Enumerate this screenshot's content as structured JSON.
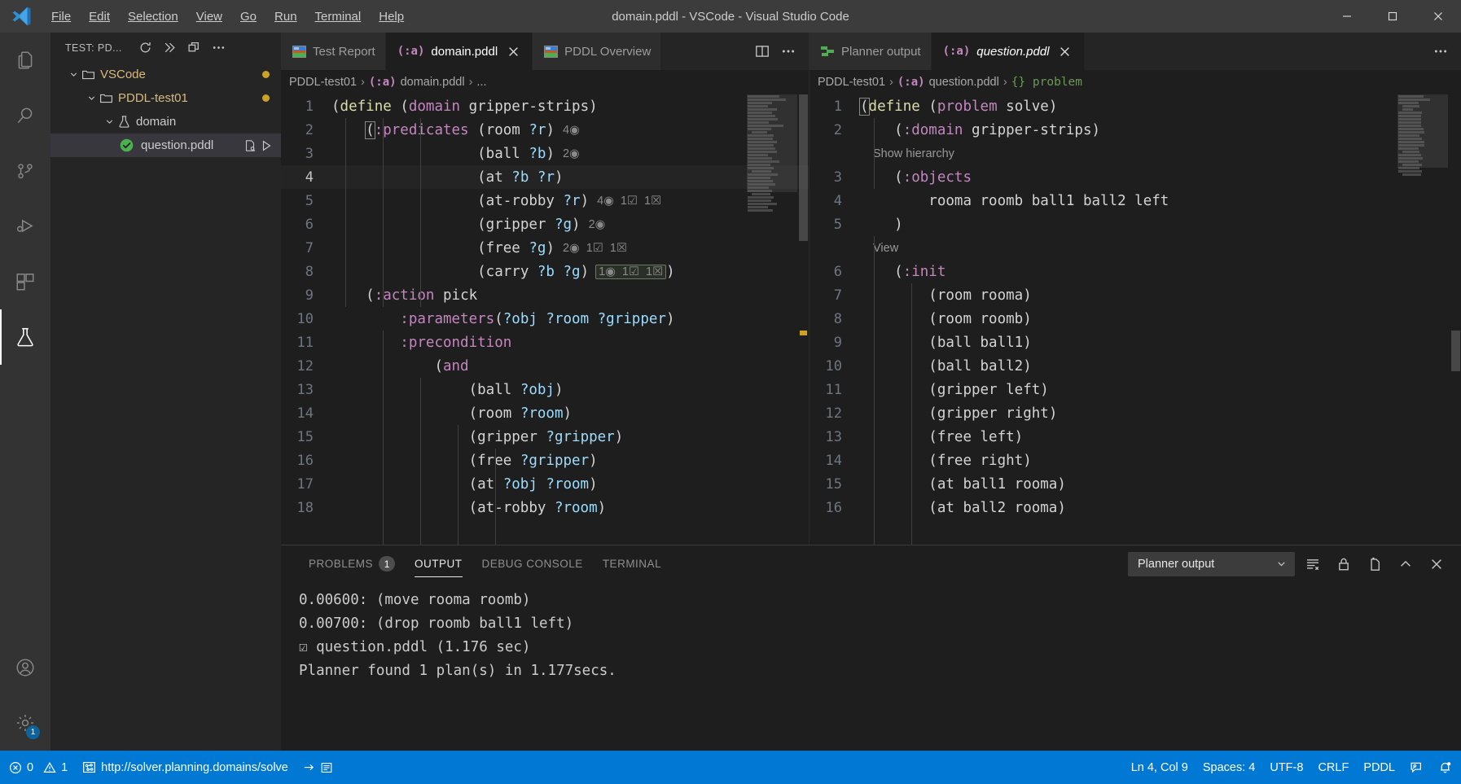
{
  "titlebar": {
    "title": "domain.pddl - VSCode - Visual Studio Code",
    "menus": [
      "File",
      "Edit",
      "Selection",
      "View",
      "Go",
      "Run",
      "Terminal",
      "Help"
    ],
    "minimize": "–",
    "maximize": "☐",
    "close": "✕"
  },
  "sidebar": {
    "header": "TEST: PD...",
    "tree": [
      {
        "label": "VSCode",
        "type": "folder",
        "indent": 0,
        "dot": true
      },
      {
        "label": "PDDL-test01",
        "type": "folder",
        "indent": 1,
        "dot": true
      },
      {
        "label": "domain",
        "type": "flask",
        "indent": 2,
        "dot": false
      },
      {
        "label": "question.pddl",
        "type": "test-pass",
        "indent": 3,
        "dot": false,
        "selected": true
      }
    ]
  },
  "left_group": {
    "tabs": [
      {
        "label": "Test Report",
        "icon": "image-icon",
        "active": false,
        "closable": false
      },
      {
        "label": "domain.pddl",
        "icon": "pddl-icon",
        "active": true,
        "closable": true
      },
      {
        "label": "PDDL Overview",
        "icon": "image-icon",
        "active": false,
        "closable": false
      }
    ],
    "breadcrumb": [
      "PDDL-test01",
      "domain.pddl",
      "..."
    ],
    "lines": [
      {
        "n": "1",
        "segs": [
          {
            "t": "(",
            "c": "paren"
          },
          {
            "t": "define ",
            "c": "name"
          },
          {
            "t": "(",
            "c": "paren"
          },
          {
            "t": "domain ",
            "c": "kw"
          },
          {
            "t": "gripper-strips",
            "c": "plain"
          },
          {
            "t": ")",
            "c": "paren"
          }
        ],
        "indent": 0
      },
      {
        "n": "2",
        "segs": [
          {
            "t": "    ",
            "c": "plain"
          },
          {
            "t": "(",
            "c": "paren",
            "cursor": true
          },
          {
            "t": ":predicates ",
            "c": "kw"
          },
          {
            "t": "(",
            "c": "paren"
          },
          {
            "t": "room ",
            "c": "pred"
          },
          {
            "t": "?r",
            "c": "var"
          },
          {
            "t": ")",
            "c": "paren"
          }
        ],
        "lens": "4◉",
        "indent": 1
      },
      {
        "n": "3",
        "segs": [
          {
            "t": "                 ",
            "c": "plain"
          },
          {
            "t": "(",
            "c": "paren"
          },
          {
            "t": "ball ",
            "c": "pred"
          },
          {
            "t": "?b",
            "c": "var"
          },
          {
            "t": ")",
            "c": "paren"
          }
        ],
        "lens": "2◉",
        "indent": 3
      },
      {
        "n": "4",
        "segs": [
          {
            "t": "                 ",
            "c": "plain"
          },
          {
            "t": "(",
            "c": "paren"
          },
          {
            "t": "at ",
            "c": "pred"
          },
          {
            "t": "?b ?r",
            "c": "var"
          },
          {
            "t": ")",
            "c": "paren"
          }
        ],
        "lens": "",
        "indent": 3,
        "current": true
      },
      {
        "n": "5",
        "segs": [
          {
            "t": "                 ",
            "c": "plain"
          },
          {
            "t": "(",
            "c": "paren"
          },
          {
            "t": "at-robby ",
            "c": "pred"
          },
          {
            "t": "?r",
            "c": "var"
          },
          {
            "t": ")",
            "c": "paren"
          }
        ],
        "lens": "4◉  1☑  1☒",
        "indent": 3
      },
      {
        "n": "6",
        "segs": [
          {
            "t": "                 ",
            "c": "plain"
          },
          {
            "t": "(",
            "c": "paren"
          },
          {
            "t": "gripper ",
            "c": "pred"
          },
          {
            "t": "?g",
            "c": "var"
          },
          {
            "t": ")",
            "c": "paren"
          }
        ],
        "lens": "2◉",
        "indent": 3
      },
      {
        "n": "7",
        "segs": [
          {
            "t": "                 ",
            "c": "plain"
          },
          {
            "t": "(",
            "c": "paren"
          },
          {
            "t": "free ",
            "c": "pred"
          },
          {
            "t": "?g",
            "c": "var"
          },
          {
            "t": ")",
            "c": "paren"
          }
        ],
        "lens": "2◉  1☑  1☒",
        "indent": 3
      },
      {
        "n": "8",
        "segs": [
          {
            "t": "                 ",
            "c": "plain"
          },
          {
            "t": "(",
            "c": "paren"
          },
          {
            "t": "carry ",
            "c": "pred"
          },
          {
            "t": "?b ?g",
            "c": "var"
          },
          {
            "t": ")",
            "c": "paren"
          }
        ],
        "lens_boxed": "1◉  1☑  1☒",
        "trail": ")",
        "indent": 3
      },
      {
        "n": "9",
        "segs": [
          {
            "t": "    ",
            "c": "plain"
          },
          {
            "t": "(",
            "c": "paren"
          },
          {
            "t": ":action ",
            "c": "kw"
          },
          {
            "t": "pick",
            "c": "plain"
          }
        ],
        "indent": 1
      },
      {
        "n": "10",
        "segs": [
          {
            "t": "        ",
            "c": "plain"
          },
          {
            "t": ":parameters",
            "c": "kw"
          },
          {
            "t": "(",
            "c": "paren"
          },
          {
            "t": "?obj ?room ?gripper",
            "c": "var"
          },
          {
            "t": ")",
            "c": "paren"
          }
        ],
        "indent": 2
      },
      {
        "n": "11",
        "segs": [
          {
            "t": "        ",
            "c": "plain"
          },
          {
            "t": ":precondition",
            "c": "kw"
          }
        ],
        "indent": 2
      },
      {
        "n": "12",
        "segs": [
          {
            "t": "            ",
            "c": "plain"
          },
          {
            "t": "(",
            "c": "paren"
          },
          {
            "t": "and",
            "c": "kw"
          }
        ],
        "indent": 3
      },
      {
        "n": "13",
        "segs": [
          {
            "t": "                ",
            "c": "plain"
          },
          {
            "t": "(",
            "c": "paren"
          },
          {
            "t": "ball ",
            "c": "pred"
          },
          {
            "t": "?obj",
            "c": "var"
          },
          {
            "t": ")",
            "c": "paren"
          }
        ],
        "indent": 4
      },
      {
        "n": "14",
        "segs": [
          {
            "t": "                ",
            "c": "plain"
          },
          {
            "t": "(",
            "c": "paren"
          },
          {
            "t": "room ",
            "c": "pred"
          },
          {
            "t": "?room",
            "c": "var"
          },
          {
            "t": ")",
            "c": "paren"
          }
        ],
        "indent": 4
      },
      {
        "n": "15",
        "segs": [
          {
            "t": "                ",
            "c": "plain"
          },
          {
            "t": "(",
            "c": "paren"
          },
          {
            "t": "gripper ",
            "c": "pred"
          },
          {
            "t": "?gripper",
            "c": "var"
          },
          {
            "t": ")",
            "c": "paren"
          }
        ],
        "indent": 4
      },
      {
        "n": "16",
        "segs": [
          {
            "t": "                ",
            "c": "plain"
          },
          {
            "t": "(",
            "c": "paren"
          },
          {
            "t": "free ",
            "c": "pred"
          },
          {
            "t": "?gripper",
            "c": "var"
          },
          {
            "t": ")",
            "c": "paren"
          }
        ],
        "indent": 4
      },
      {
        "n": "17",
        "segs": [
          {
            "t": "                ",
            "c": "plain"
          },
          {
            "t": "(",
            "c": "paren"
          },
          {
            "t": "at ",
            "c": "pred"
          },
          {
            "t": "?obj ?room",
            "c": "var"
          },
          {
            "t": ")",
            "c": "paren"
          }
        ],
        "indent": 4
      },
      {
        "n": "18",
        "segs": [
          {
            "t": "                ",
            "c": "plain"
          },
          {
            "t": "(",
            "c": "paren"
          },
          {
            "t": "at-robby ",
            "c": "pred"
          },
          {
            "t": "?room",
            "c": "var"
          },
          {
            "t": ")",
            "c": "paren"
          }
        ],
        "indent": 4
      }
    ]
  },
  "right_group": {
    "tabs": [
      {
        "label": "Planner output",
        "icon": "planner-icon",
        "active": false,
        "closable": false
      },
      {
        "label": "question.pddl",
        "icon": "pddl-icon",
        "active": true,
        "closable": true,
        "italic": true
      }
    ],
    "breadcrumb": [
      "PDDL-test01",
      "question.pddl",
      "{} problem"
    ],
    "lines": [
      {
        "n": "1",
        "segs": [
          {
            "t": "(",
            "c": "paren",
            "cursor": true
          },
          {
            "t": "define ",
            "c": "name"
          },
          {
            "t": "(",
            "c": "paren"
          },
          {
            "t": "problem ",
            "c": "kw"
          },
          {
            "t": "solve",
            "c": "plain"
          },
          {
            "t": ")",
            "c": "paren"
          }
        ]
      },
      {
        "n": "2",
        "segs": [
          {
            "t": "    ",
            "c": "plain"
          },
          {
            "t": "(",
            "c": "paren"
          },
          {
            "t": ":domain ",
            "c": "kw"
          },
          {
            "t": "gripper-strips",
            "c": "plain"
          },
          {
            "t": ")",
            "c": "paren"
          }
        ]
      },
      {
        "n": "",
        "codelens": "Show hierarchy"
      },
      {
        "n": "3",
        "segs": [
          {
            "t": "    ",
            "c": "plain"
          },
          {
            "t": "(",
            "c": "paren"
          },
          {
            "t": ":objects",
            "c": "kw"
          }
        ]
      },
      {
        "n": "4",
        "segs": [
          {
            "t": "        ",
            "c": "plain"
          },
          {
            "t": "rooma roomb ball1 ball2 left",
            "c": "plain"
          }
        ]
      },
      {
        "n": "5",
        "segs": [
          {
            "t": "    ",
            "c": "plain"
          },
          {
            "t": ")",
            "c": "paren"
          }
        ]
      },
      {
        "n": "",
        "codelens": "View"
      },
      {
        "n": "6",
        "segs": [
          {
            "t": "    ",
            "c": "plain"
          },
          {
            "t": "(",
            "c": "paren"
          },
          {
            "t": ":init",
            "c": "kw"
          }
        ]
      },
      {
        "n": "7",
        "segs": [
          {
            "t": "        ",
            "c": "plain"
          },
          {
            "t": "(",
            "c": "paren"
          },
          {
            "t": "room rooma",
            "c": "plain"
          },
          {
            "t": ")",
            "c": "paren"
          }
        ]
      },
      {
        "n": "8",
        "segs": [
          {
            "t": "        ",
            "c": "plain"
          },
          {
            "t": "(",
            "c": "paren"
          },
          {
            "t": "room roomb",
            "c": "plain"
          },
          {
            "t": ")",
            "c": "paren"
          }
        ]
      },
      {
        "n": "9",
        "segs": [
          {
            "t": "        ",
            "c": "plain"
          },
          {
            "t": "(",
            "c": "paren"
          },
          {
            "t": "ball ball1",
            "c": "plain"
          },
          {
            "t": ")",
            "c": "paren"
          }
        ]
      },
      {
        "n": "10",
        "segs": [
          {
            "t": "        ",
            "c": "plain"
          },
          {
            "t": "(",
            "c": "paren"
          },
          {
            "t": "ball ball2",
            "c": "plain"
          },
          {
            "t": ")",
            "c": "paren"
          }
        ]
      },
      {
        "n": "11",
        "segs": [
          {
            "t": "        ",
            "c": "plain"
          },
          {
            "t": "(",
            "c": "paren"
          },
          {
            "t": "gripper left",
            "c": "plain"
          },
          {
            "t": ")",
            "c": "paren"
          }
        ]
      },
      {
        "n": "12",
        "segs": [
          {
            "t": "        ",
            "c": "plain"
          },
          {
            "t": "(",
            "c": "paren"
          },
          {
            "t": "gripper right",
            "c": "plain"
          },
          {
            "t": ")",
            "c": "paren"
          }
        ]
      },
      {
        "n": "13",
        "segs": [
          {
            "t": "        ",
            "c": "plain"
          },
          {
            "t": "(",
            "c": "paren"
          },
          {
            "t": "free left",
            "c": "plain"
          },
          {
            "t": ")",
            "c": "paren"
          }
        ]
      },
      {
        "n": "14",
        "segs": [
          {
            "t": "        ",
            "c": "plain"
          },
          {
            "t": "(",
            "c": "paren"
          },
          {
            "t": "free right",
            "c": "plain"
          },
          {
            "t": ")",
            "c": "paren"
          }
        ]
      },
      {
        "n": "15",
        "segs": [
          {
            "t": "        ",
            "c": "plain"
          },
          {
            "t": "(",
            "c": "paren"
          },
          {
            "t": "at ball1 rooma",
            "c": "plain"
          },
          {
            "t": ")",
            "c": "paren"
          }
        ]
      },
      {
        "n": "16",
        "segs": [
          {
            "t": "        ",
            "c": "plain"
          },
          {
            "t": "(",
            "c": "paren"
          },
          {
            "t": "at ball2 rooma",
            "c": "plain"
          },
          {
            "t": ")",
            "c": "paren"
          }
        ]
      }
    ]
  },
  "panel": {
    "tabs": [
      {
        "label": "PROBLEMS",
        "badge": "1",
        "active": false
      },
      {
        "label": "OUTPUT",
        "badge": "",
        "active": true
      },
      {
        "label": "DEBUG CONSOLE",
        "badge": "",
        "active": false
      },
      {
        "label": "TERMINAL",
        "badge": "",
        "active": false
      }
    ],
    "output_channel": "Planner output",
    "lines": [
      "0.00600: (move rooma roomb)",
      "0.00700: (drop roomb ball1 left)",
      "☑ question.pddl (1.176 sec)",
      "Planner found 1 plan(s) in 1.177secs."
    ]
  },
  "statusbar": {
    "errors": "0",
    "warnings": "1",
    "solver_url": "http://solver.planning.domains/solve",
    "position": "Ln 4, Col 9",
    "spaces": "Spaces: 4",
    "encoding": "UTF-8",
    "eol": "CRLF",
    "language": "PDDL",
    "accent": "#0078d4"
  }
}
